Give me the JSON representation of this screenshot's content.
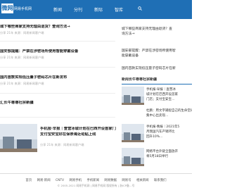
{
  "header": {
    "logo_mark": "微网",
    "logo_sub": "网易手机网",
    "nav": [
      "新闻",
      "分刊",
      "新际",
      "智库"
    ]
  },
  "main": {
    "items": [
      {
        "title": "城下哪些商家支持无理由退货？查询方法→",
        "meta": "分享  21年 来源：网易新闻客户端"
      },
      {
        "title": "国安部提醒：严禁在涉密场所使用智能穿戴设备",
        "meta": "分享  21年 来源：网易新闻客户端"
      },
      {
        "title": "国内首款实现低压量子密码芯片在新发布",
        "meta": "分享  21年 来源：网易新闻客户端"
      },
      {
        "title": "汇长牛尊尊社宗新疆",
        "meta": ""
      }
    ],
    "feature": {
      "title_line1": "手机报·早报｜查营冰城计划在巴西开设首家门店；",
      "title_line2": "支付宝安宝好在保亲海近动贴上线",
      "meta": "分享  21年 来源：网易新闻客户端"
    }
  },
  "sidebar": {
    "lines": [
      "城下哪些商家支持无理由退货？查",
      "询方法→",
      "",
      "国安部提醒：严禁在涉密场所使用智",
      "能穿戴设备",
      "",
      "国内首款实现低压量子密码芯片在新"
    ],
    "section": "新闻长牛尊尊社宗新疆",
    "cards": [
      {
        "lines": [
          "手机报·早报｜查营冰",
          "城计划在巴西开设首家",
          "门店；支付宝安宝..."
        ]
      },
      {
        "lines": [
          "杜鹏：用文字捕捉自己的生命空间；清",
          "集中心出卖现..."
        ]
      },
      {
        "lines": [
          "手机报·晚报｜2021年5",
          "月我国汽车产销环比",
          "回升10%..."
        ]
      },
      {
        "lines": [
          "网络平台外链全面放开",
          "将5月18日举行"
        ]
      }
    ]
  },
  "footer": {
    "links": [
      "首页",
      "网易·新闻",
      "CNTV",
      "网易手机",
      "手机新闻",
      "网易数据",
      "网易号",
      "相关新闻",
      "联系我们"
    ],
    "copyright": "© 2005-2021 网易手机网 | 网易手机网 版权所有 | 浙ICP备…号"
  },
  "colors": {
    "brand": "#1f6fb5",
    "muted": "#aaaaaa"
  }
}
